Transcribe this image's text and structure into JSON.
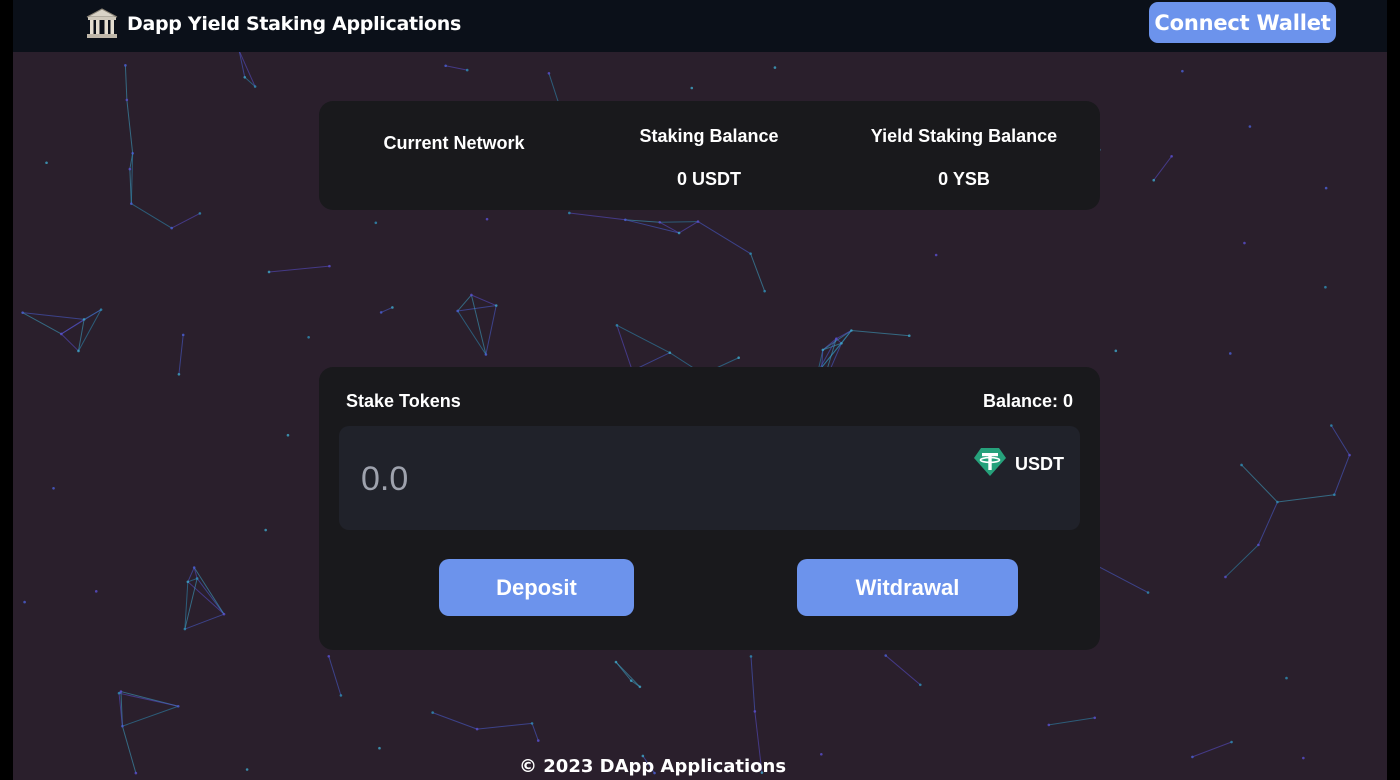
{
  "header": {
    "brand_icon": "bank-building-icon",
    "title": "Dapp Yield Staking Applications",
    "connect_label": "Connect Wallet"
  },
  "stats": {
    "network_label": "Current Network",
    "network_value": "",
    "staking_label": "Staking Balance",
    "staking_value": "0 USDT",
    "yield_label": "Yield Staking Balance",
    "yield_value": "0 YSB"
  },
  "stake": {
    "title": "Stake Tokens",
    "balance": "Balance: 0",
    "amount_placeholder": "0.0",
    "token_icon": "tether-usdt-icon",
    "token": "USDT",
    "deposit_label": "Deposit",
    "withdraw_label": "Witdrawal"
  },
  "footer": {
    "text": "© 2023 DApp Applications"
  },
  "colors": {
    "background": "#2a1f2c",
    "topbar": "#0b1019",
    "card": "#19191c",
    "input": "#20222a",
    "accent": "#6c93ec",
    "tether": "#26a17b"
  }
}
